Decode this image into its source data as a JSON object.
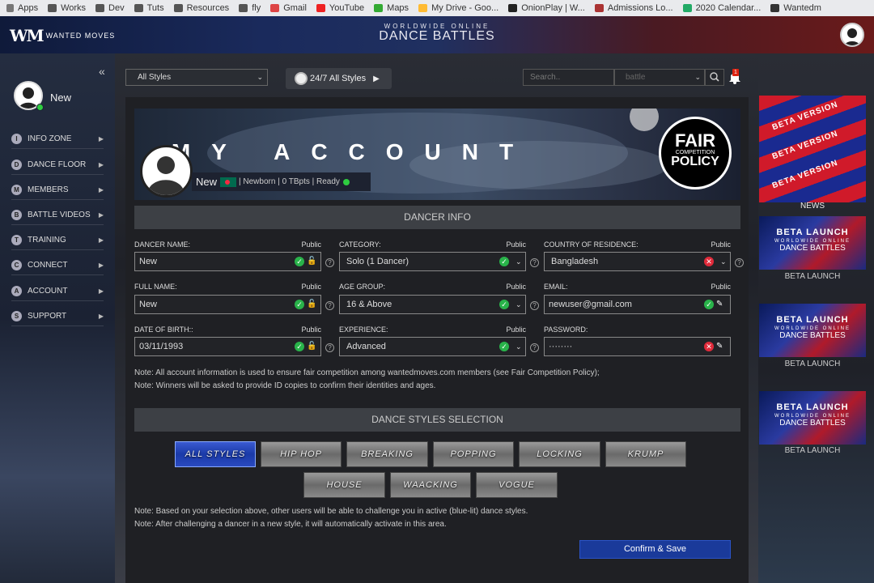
{
  "bookmarks": [
    "Apps",
    "Works",
    "Dev",
    "Tuts",
    "Resources",
    "fly",
    "Gmail",
    "YouTube",
    "Maps",
    "My Drive - Goo...",
    "OnionPlay | W...",
    "Admissions Lo...",
    "2020 Calendar...",
    "Wantedm"
  ],
  "brand": {
    "logo": "WM",
    "logo_text": "WANTED MOVES",
    "title_small": "WORLDWIDE ONLINE",
    "title_big": "DANCE BATTLES"
  },
  "user": {
    "name": "New"
  },
  "nav": [
    {
      "letter": "I",
      "label": "INFO ZONE"
    },
    {
      "letter": "D",
      "label": "DANCE FLOOR"
    },
    {
      "letter": "M",
      "label": "MEMBERS"
    },
    {
      "letter": "B",
      "label": "BATTLE VIDEOS"
    },
    {
      "letter": "T",
      "label": "TRAINING"
    },
    {
      "letter": "C",
      "label": "CONNECT"
    },
    {
      "letter": "A",
      "label": "ACCOUNT"
    },
    {
      "letter": "S",
      "label": "SUPPORT"
    }
  ],
  "toolbar": {
    "style_select": "All Styles",
    "live_label": "24/7 All Styles",
    "search_placeholder": "Search..",
    "battle_select": "battle",
    "notif_count": "1"
  },
  "hero": {
    "title": "MY ACCOUNT",
    "status_name": "New",
    "status_text": "| Newborn | 0 TBpts | Ready",
    "fair_1": "FAIR",
    "fair_2": "COMPETITION",
    "fair_3": "POLICY"
  },
  "sections": {
    "dancer_info": "DANCER INFO",
    "dance_styles": "DANCE STYLES SELECTION"
  },
  "fields": {
    "dancer_name": {
      "label": "DANCER NAME:",
      "visibility": "Public",
      "value": "New"
    },
    "full_name": {
      "label": "FULL NAME:",
      "visibility": "Public",
      "value": "New"
    },
    "dob": {
      "label": "DATE OF BIRTH::",
      "visibility": "Public",
      "value": "03/11/1993"
    },
    "category": {
      "label": "CATEGORY:",
      "visibility": "Public",
      "value": "Solo (1 Dancer)"
    },
    "age_group": {
      "label": "AGE GROUP:",
      "visibility": "Public",
      "value": "16 & Above"
    },
    "experience": {
      "label": "EXPERIENCE:",
      "visibility": "Public",
      "value": "Advanced"
    },
    "country": {
      "label": "COUNTRY OF RESIDENCE:",
      "visibility": "Public",
      "value": "Bangladesh"
    },
    "email": {
      "label": "EMAIL:",
      "visibility": "Public",
      "value": "newuser@gmail.com"
    },
    "password": {
      "label": "PASSWORD:",
      "value": "········"
    }
  },
  "notes": {
    "n1": "Note: All account information is used to ensure fair competition among wantedmoves.com members (see Fair Competition Policy);",
    "n2": "Note: Winners will be asked to provide ID copies to confirm their identities and ages.",
    "n3": "Note: Based on your selection above, other users will be able to challenge you in active (blue-lit) dance styles.",
    "n4": "Note: After challenging a dancer in a new style, it will automatically activate in this area."
  },
  "styles": [
    "ALL STYLES",
    "HIP HOP",
    "BREAKING",
    "POPPING",
    "LOCKING",
    "KRUMP",
    "HOUSE",
    "WAACKING",
    "VOGUE"
  ],
  "active_style": "ALL STYLES",
  "confirm_label": "Confirm & Save",
  "right": {
    "beta_version": "BETA VERSION",
    "news": "NEWS",
    "card_t1": "BETA LAUNCH",
    "card_t2": "WORLDWIDE ONLINE",
    "card_t3": "DANCE BATTLES",
    "card_label": "BETA LAUNCH"
  },
  "colors": {
    "accent_blue": "#1a3a9a",
    "ok_green": "#29b34a",
    "error_red": "#e02a3a"
  }
}
